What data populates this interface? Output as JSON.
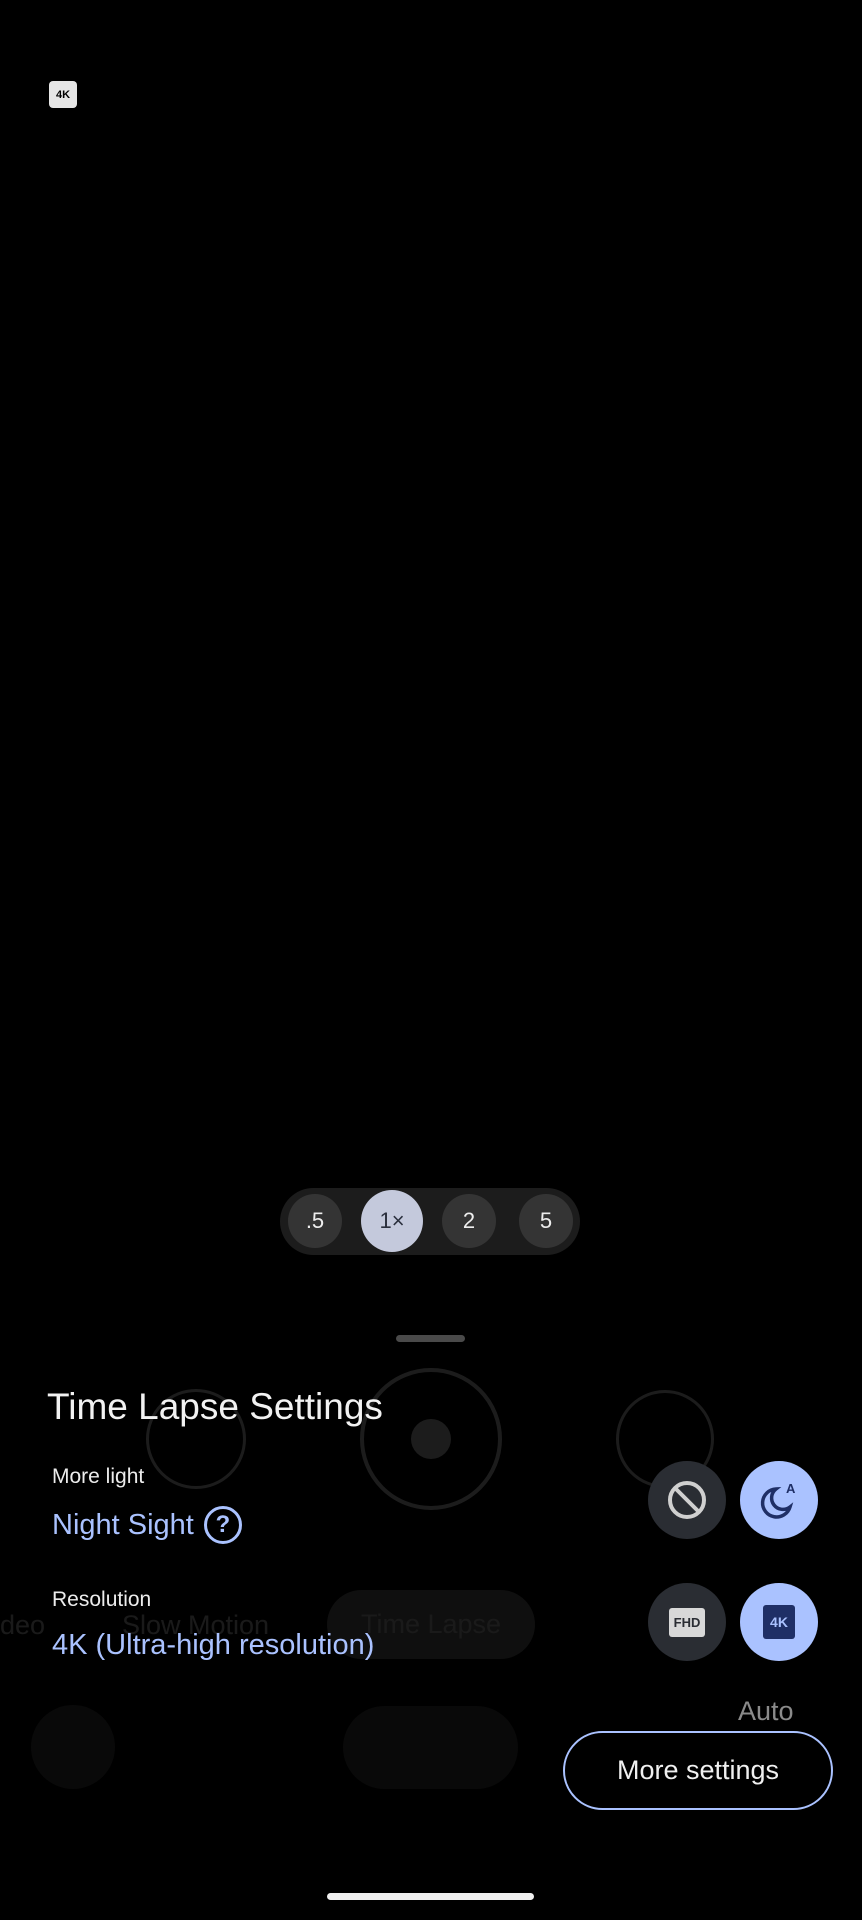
{
  "viewfinder": {
    "resolution_badge": "4K"
  },
  "zoom": {
    "options": [
      ".5",
      "1×",
      "2",
      "5"
    ],
    "selected": "1×"
  },
  "background_controls": {
    "modes": [
      "deo",
      "Slow Motion",
      "Time Lapse"
    ],
    "active_mode": "Time Lapse",
    "auto_label": "Auto"
  },
  "sheet": {
    "title": "Time Lapse Settings",
    "more_light": {
      "label": "More light",
      "value": "Night Sight",
      "options": [
        "off",
        "night-sight-auto"
      ],
      "selected": "night-sight-auto"
    },
    "resolution": {
      "label": "Resolution",
      "value": "4K (Ultra-high resolution)",
      "options": [
        "FHD",
        "4K"
      ],
      "selected": "4K"
    },
    "more_settings": "More settings"
  },
  "colors": {
    "accent": "#aac2ff",
    "selected_zoom": "#c4c9dc"
  }
}
